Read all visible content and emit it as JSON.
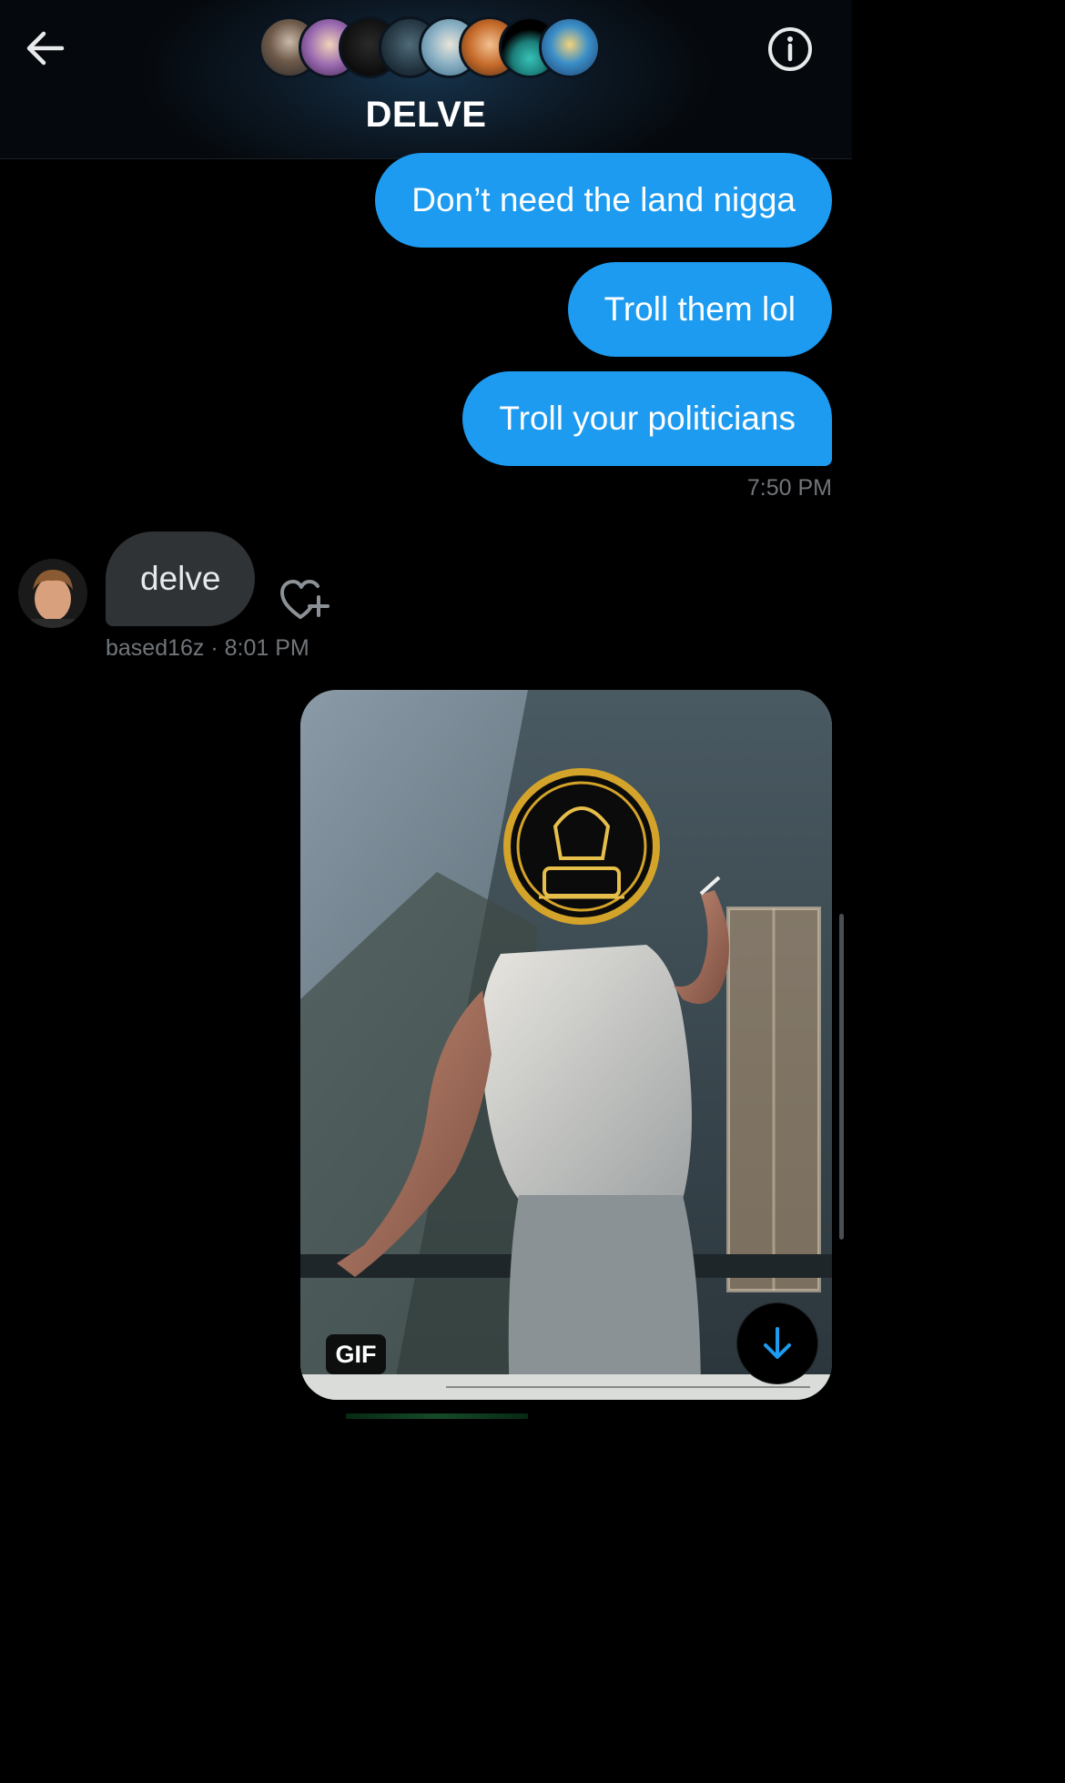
{
  "header": {
    "title": "DELVE",
    "back_icon": "arrow-left-icon",
    "info_icon": "info-circle-icon",
    "participant_count": 8
  },
  "messages_outgoing": [
    {
      "text": "Don’t need the land nigga"
    },
    {
      "text": "Troll them lol"
    },
    {
      "text": "Troll your politicians"
    }
  ],
  "outgoing_timestamp": "7:50 PM",
  "incoming": {
    "text": "delve",
    "username": "based16z",
    "separator": " · ",
    "time": "8:01 PM",
    "react_icon": "heart-plus-icon"
  },
  "gif": {
    "badge": "GIF"
  },
  "scroll_button": {
    "icon": "arrow-down-icon"
  },
  "colors": {
    "outgoing_bubble": "#1d9bf0",
    "incoming_bubble": "#2f3336",
    "meta_text": "#71767b",
    "background": "#000000"
  }
}
